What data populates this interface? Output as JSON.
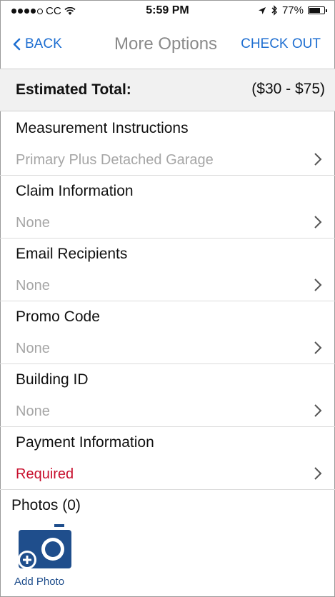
{
  "status_bar": {
    "carrier": "CC",
    "signal_filled": 4,
    "signal_total": 5,
    "time": "5:59 PM",
    "battery_percent": "77%",
    "battery_level": 0.77
  },
  "nav": {
    "back_label": "BACK",
    "title": "More Options",
    "checkout_label": "CHECK OUT"
  },
  "estimate": {
    "label": "Estimated Total:",
    "value": "($30 - $75)"
  },
  "options": [
    {
      "title": "Measurement Instructions",
      "value": "Primary Plus Detached Garage"
    },
    {
      "title": "Claim Information",
      "value": "None"
    },
    {
      "title": "Email Recipients",
      "value": "None"
    },
    {
      "title": "Promo Code",
      "value": "None"
    },
    {
      "title": "Building ID",
      "value": "None"
    },
    {
      "title": "Payment Information",
      "value": "Required"
    }
  ],
  "photos": {
    "title": "Photos (0)",
    "add_label": "Add Photo"
  },
  "colors": {
    "link_blue": "#1f6fd1",
    "required_red": "#c8102e",
    "camera_blue": "#1f4e8c"
  }
}
